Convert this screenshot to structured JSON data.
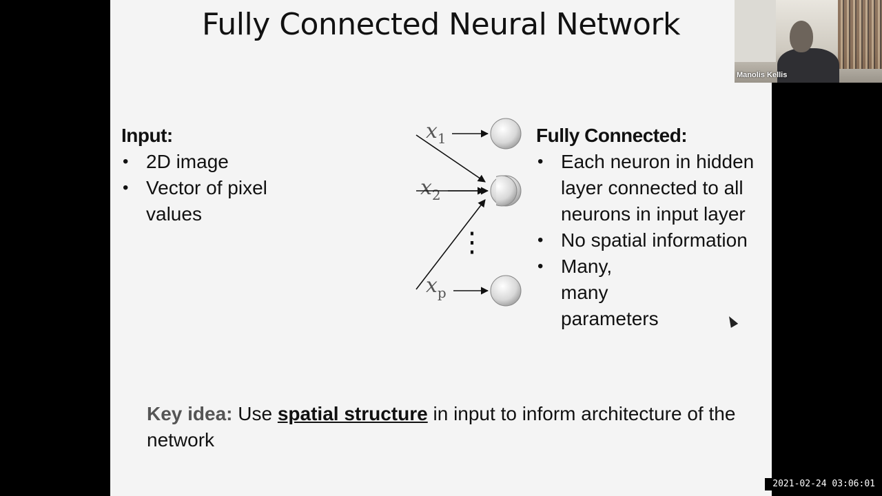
{
  "slide": {
    "title": "Fully Connected Neural Network",
    "input_section": {
      "heading": "Input:",
      "bullets": [
        "2D image",
        "Vector of pixel values"
      ]
    },
    "connected_section": {
      "heading": "Fully Connected:",
      "bullets": [
        "Each neuron in hidden layer connected to all neurons in input layer",
        "No spatial information",
        "Many, many parameters"
      ]
    },
    "diagram": {
      "inputs": [
        {
          "var": "x",
          "sub": "1"
        },
        {
          "var": "x",
          "sub": "2"
        },
        {
          "var": "x",
          "sub": "p"
        }
      ],
      "ellipsis": "⋮"
    },
    "key_idea": {
      "label": "Key idea:",
      "text_before": " Use ",
      "emphasis": "spatial structure",
      "text_after": " in input to inform architecture of the network"
    }
  },
  "video": {
    "participant_name": "Manolis Kellis"
  },
  "timestamp": "2021-02-24 03:06:01"
}
